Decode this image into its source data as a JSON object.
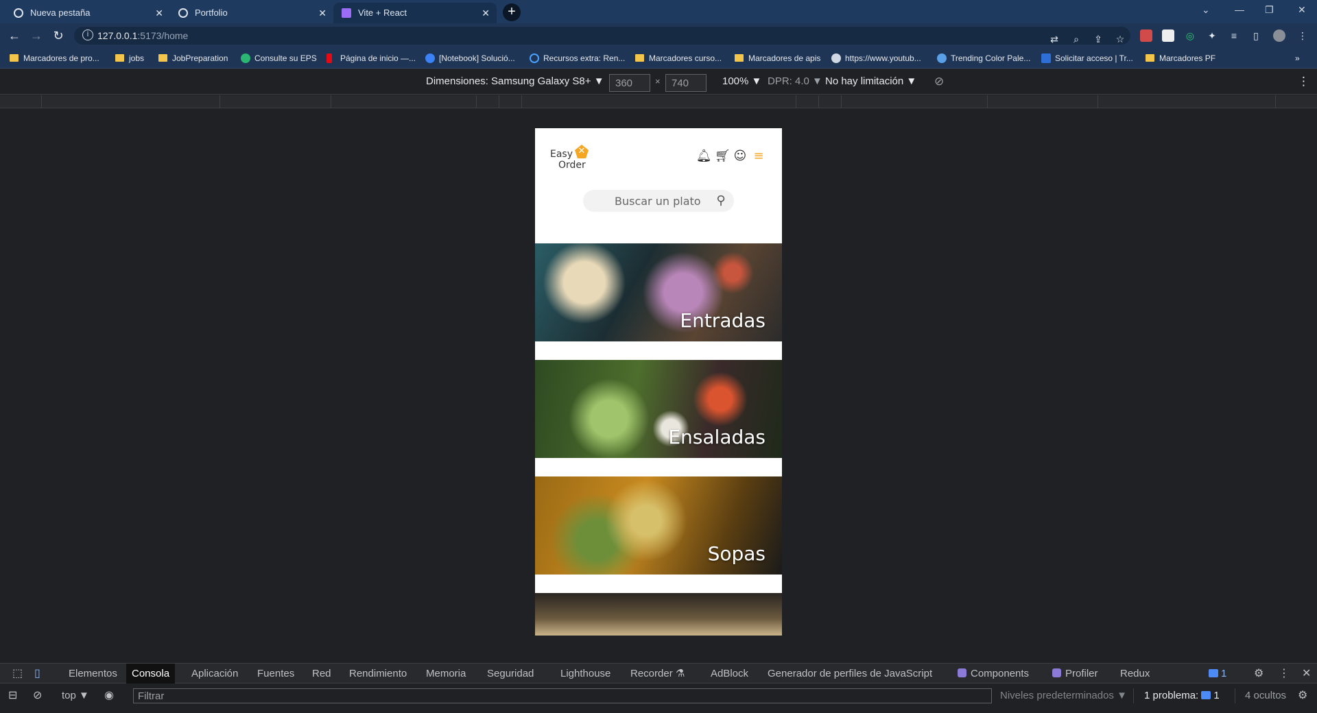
{
  "browser": {
    "tabs": [
      {
        "title": "Nueva pestaña"
      },
      {
        "title": "Portfolio"
      },
      {
        "title": "Vite + React"
      }
    ],
    "url_host": "127.0.0.1",
    "url_path": ":5173/home",
    "bookmarks": [
      {
        "label": "Marcadores de pro...",
        "kind": "folder"
      },
      {
        "label": "jobs",
        "kind": "folder"
      },
      {
        "label": "JobPreparation",
        "kind": "folder"
      },
      {
        "label": "Consulte su EPS",
        "kind": "link"
      },
      {
        "label": "Página de inicio —...",
        "kind": "link"
      },
      {
        "label": "[Notebook] Solució...",
        "kind": "link"
      },
      {
        "label": "Recursos extra: Ren...",
        "kind": "link"
      },
      {
        "label": "Marcadores curso...",
        "kind": "folder"
      },
      {
        "label": "Marcadores de apis",
        "kind": "folder"
      },
      {
        "label": "https://www.youtub...",
        "kind": "link"
      },
      {
        "label": "Trending Color Pale...",
        "kind": "link"
      },
      {
        "label": "Solicitar acceso | Tr...",
        "kind": "link"
      },
      {
        "label": "Marcadores PF",
        "kind": "folder"
      }
    ]
  },
  "device_toolbar": {
    "device": "Dimensiones: Samsung Galaxy S8+",
    "width": "360",
    "height": "740",
    "times": "×",
    "zoom": "100%",
    "dpr": "DPR: 4.0",
    "throttle": "No hay limitación"
  },
  "app": {
    "logo_line1": "Easy",
    "logo_line2": "Order",
    "search_placeholder": "Buscar un plato",
    "categories": [
      {
        "label": "Entradas"
      },
      {
        "label": "Ensaladas"
      },
      {
        "label": "Sopas"
      },
      {
        "label": ""
      }
    ],
    "accent_color": "#f5a623"
  },
  "devtools": {
    "tabs": [
      {
        "label": "Elementos"
      },
      {
        "label": "Consola"
      },
      {
        "label": "Aplicación"
      },
      {
        "label": "Fuentes"
      },
      {
        "label": "Red"
      },
      {
        "label": "Rendimiento"
      },
      {
        "label": "Memoria"
      },
      {
        "label": "Seguridad"
      },
      {
        "label": "Lighthouse"
      },
      {
        "label": "Recorder"
      },
      {
        "label": "AdBlock"
      },
      {
        "label": "Generador de perfiles de JavaScript"
      },
      {
        "label": "Components"
      },
      {
        "label": "Profiler"
      },
      {
        "label": "Redux"
      }
    ],
    "active_tab": "Consola",
    "issues_badge": "1",
    "context": "top",
    "filter_placeholder": "Filtrar",
    "levels": "Niveles predeterminados",
    "problems": "1 problema:",
    "problems_count": "1",
    "hidden": "4 ocultos"
  }
}
